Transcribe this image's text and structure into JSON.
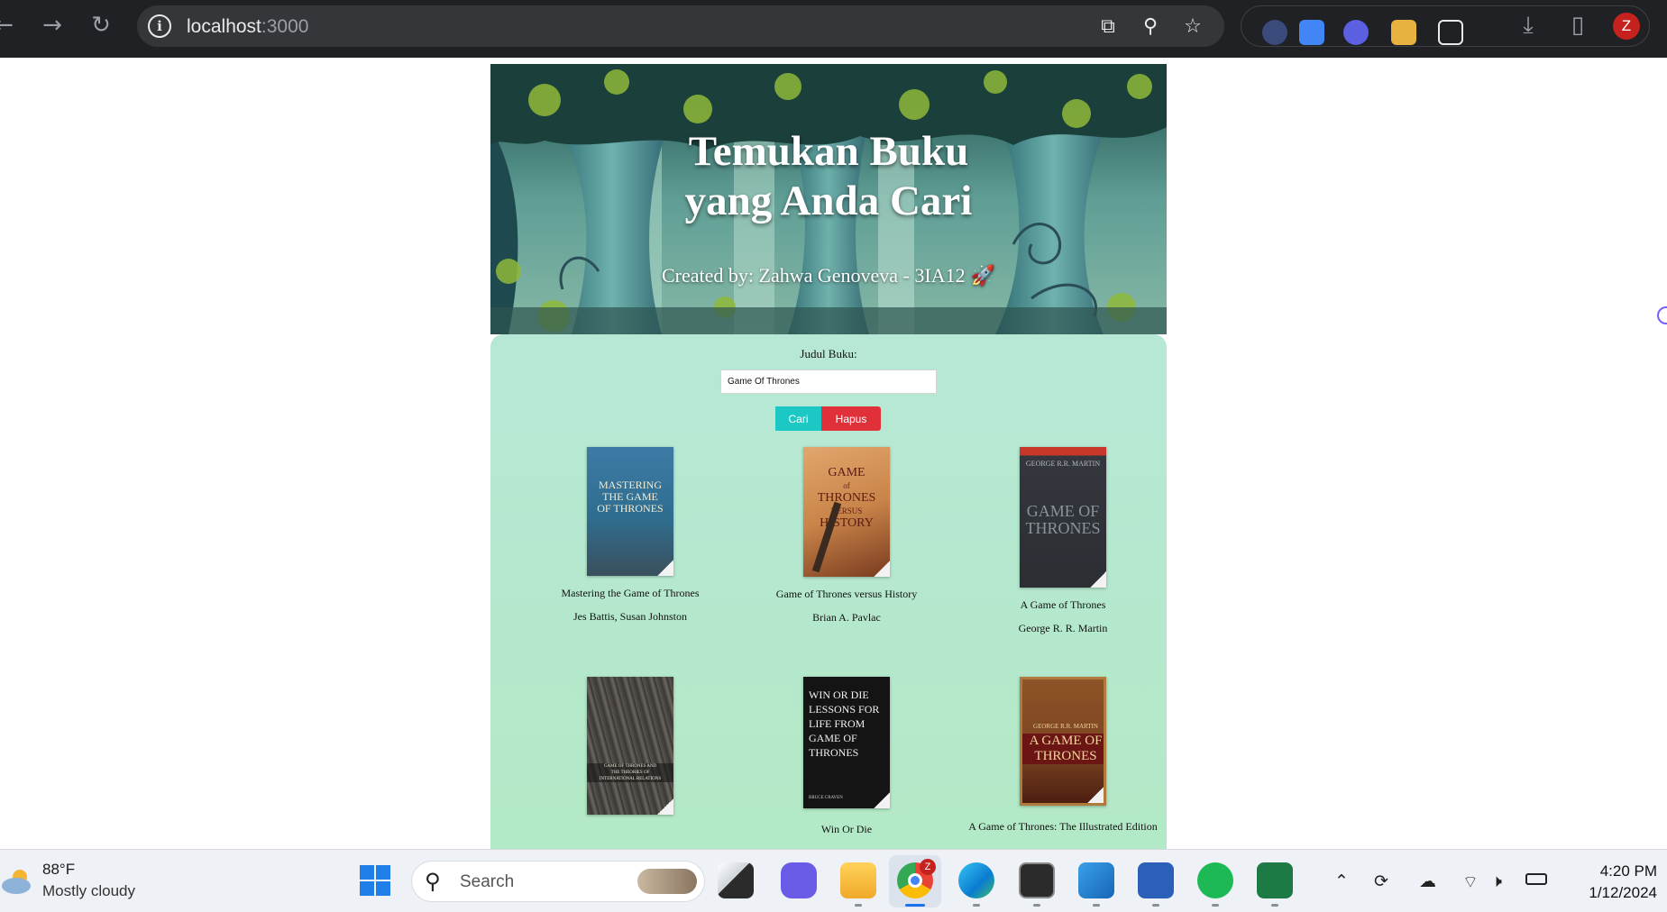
{
  "browser": {
    "url_host": "localhost",
    "url_port": ":3000",
    "profile_initial": "Z"
  },
  "hero": {
    "title_line1": "Temukan Buku",
    "title_line2": "yang Anda Cari",
    "subtitle": "Created by: Zahwa Genoveva - 3IA12",
    "subtitle_emoji": "🚀"
  },
  "search": {
    "label": "Judul Buku:",
    "value": "Game Of Thrones",
    "search_button": "Cari",
    "clear_button": "Hapus"
  },
  "books": [
    {
      "title": "Mastering the Game of Thrones",
      "author": "Jes Battis, Susan Johnston",
      "cover_text": [
        "MASTERING",
        "THE GAME",
        "OF THRONES"
      ],
      "cover_color": "#2f6d8f"
    },
    {
      "title": "Game of Thrones versus History",
      "author": "Brian A. Pavlac",
      "cover_text": [
        "GAME",
        "of",
        "THRONES",
        "VERSUS",
        "HISTORY"
      ],
      "cover_color": "#c9854a"
    },
    {
      "title": "A Game of Thrones",
      "author": "George R. R. Martin",
      "cover_text": [
        "GEORGE R.R. MARTIN",
        "GAME OF",
        "THRONES"
      ],
      "cover_color": "#2b2e33"
    },
    {
      "title": "",
      "author": "",
      "cover_text": [
        "GAME OF THRONES AND",
        "THE THEORIES OF",
        "INTERNATIONAL RELATIONS"
      ],
      "cover_color": "#4a4744"
    },
    {
      "title": "Win Or Die",
      "author": "",
      "cover_text": [
        "WIN OR DIE",
        "LESSONS FOR",
        "LIFE FROM",
        "GAME OF",
        "THRONES",
        "BRUCE CRAVEN"
      ],
      "cover_color": "#141414"
    },
    {
      "title": "A Game of Thrones: The Illustrated Edition",
      "author": "",
      "cover_text": [
        "GEORGE R.R. MARTIN",
        "A GAME OF",
        "THRONES"
      ],
      "cover_color": "#7a4421"
    }
  ],
  "taskbar": {
    "temperature": "88°F",
    "condition": "Mostly cloudy",
    "search_placeholder": "Search",
    "time": "4:20 PM",
    "date": "1/12/2024",
    "chrome_badge": "Z"
  }
}
